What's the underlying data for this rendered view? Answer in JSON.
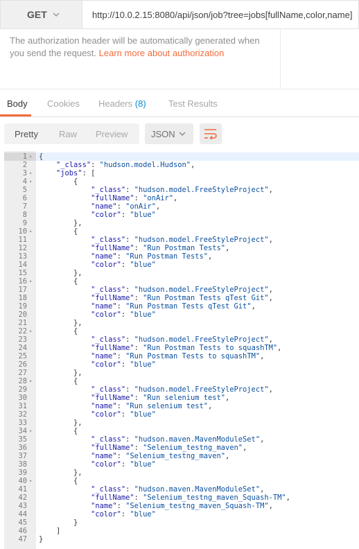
{
  "request": {
    "method": "GET",
    "url": "http://10.0.2.15:8080/api/json/job?tree=jobs[fullName,color,name]"
  },
  "auth": {
    "note": "The authorization header will be automatically generated when you send the request.",
    "link_text": "Learn more about authorization"
  },
  "response_tabs": [
    {
      "label": "Body"
    },
    {
      "label": "Cookies"
    },
    {
      "label": "Headers",
      "count": "(8)"
    },
    {
      "label": "Test Results"
    }
  ],
  "view_modes": [
    "Pretty",
    "Raw",
    "Preview"
  ],
  "active_view": "Pretty",
  "format": "JSON",
  "colors": {
    "accent": "#f26b3a",
    "count": "#0a88d4"
  },
  "icons": [
    "chevron-down-icon",
    "wrap-lines-icon",
    "fold-arrow-icon"
  ],
  "code_lines": [
    "{",
    "    \"_class\": \"hudson.model.Hudson\",",
    "    \"jobs\": [",
    "        {",
    "            \"_class\": \"hudson.model.FreeStyleProject\",",
    "            \"fullName\": \"onAir\",",
    "            \"name\": \"onAir\",",
    "            \"color\": \"blue\"",
    "        },",
    "        {",
    "            \"_class\": \"hudson.model.FreeStyleProject\",",
    "            \"fullName\": \"Run Postman Tests\",",
    "            \"name\": \"Run Postman Tests\",",
    "            \"color\": \"blue\"",
    "        },",
    "        {",
    "            \"_class\": \"hudson.model.FreeStyleProject\",",
    "            \"fullName\": \"Run Postman Tests qTest Git\",",
    "            \"name\": \"Run Postman Tests qTest Git\",",
    "            \"color\": \"blue\"",
    "        },",
    "        {",
    "            \"_class\": \"hudson.model.FreeStyleProject\",",
    "            \"fullName\": \"Run Postman Tests to squashTM\",",
    "            \"name\": \"Run Postman Tests to squashTM\",",
    "            \"color\": \"blue\"",
    "        },",
    "        {",
    "            \"_class\": \"hudson.model.FreeStyleProject\",",
    "            \"fullName\": \"Run selenium test\",",
    "            \"name\": \"Run selenium test\",",
    "            \"color\": \"blue\"",
    "        },",
    "        {",
    "            \"_class\": \"hudson.maven.MavenModuleSet\",",
    "            \"fullName\": \"Selenium_testng_maven\",",
    "            \"name\": \"Selenium_testng_maven\",",
    "            \"color\": \"blue\"",
    "        },",
    "        {",
    "            \"_class\": \"hudson.maven.MavenModuleSet\",",
    "            \"fullName\": \"Selenium_testng_maven_Squash-TM\",",
    "            \"name\": \"Selenium_testng_maven_Squash-TM\",",
    "            \"color\": \"blue\"",
    "        }",
    "    ]",
    "}"
  ],
  "foldable_lines": [
    1,
    3,
    4,
    10,
    16,
    22,
    28,
    34,
    40
  ]
}
